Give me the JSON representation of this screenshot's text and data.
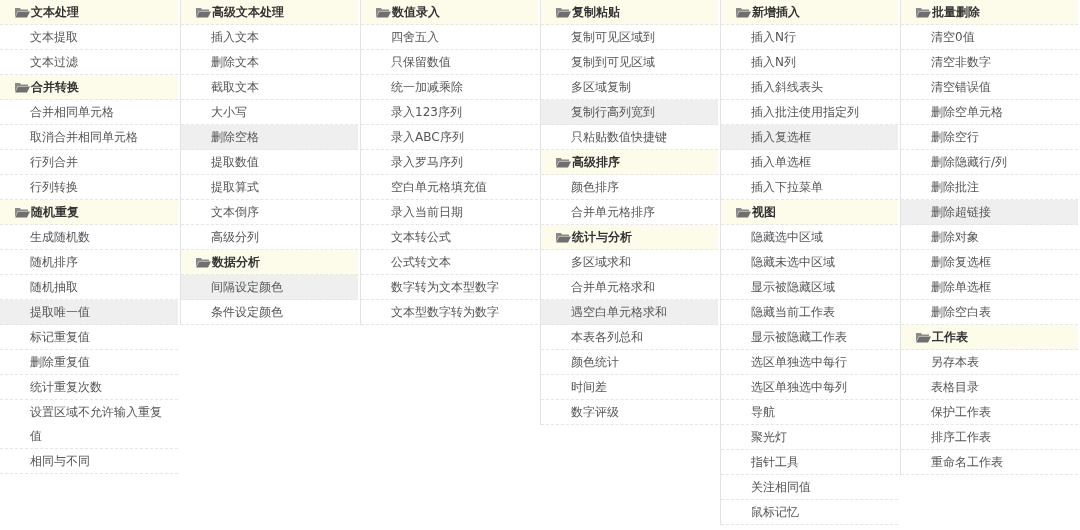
{
  "columns": [
    {
      "groups": [
        {
          "title": "文本处理",
          "items": [
            {
              "label": "文本提取",
              "selected": false
            },
            {
              "label": "文本过滤",
              "selected": false
            }
          ]
        },
        {
          "title": "合并转换",
          "items": [
            {
              "label": "合并相同单元格",
              "selected": false
            },
            {
              "label": "取消合并相同单元格",
              "selected": false
            },
            {
              "label": "行列合并",
              "selected": false
            },
            {
              "label": "行列转换",
              "selected": false
            }
          ]
        },
        {
          "title": "随机重复",
          "items": [
            {
              "label": "生成随机数",
              "selected": false
            },
            {
              "label": "随机排序",
              "selected": false
            },
            {
              "label": "随机抽取",
              "selected": false
            },
            {
              "label": "提取唯一值",
              "selected": true
            },
            {
              "label": "标记重复值",
              "selected": false
            },
            {
              "label": "删除重复值",
              "selected": false
            },
            {
              "label": "统计重复次数",
              "selected": false
            },
            {
              "label": "设置区域不允许输入重复值",
              "selected": false
            },
            {
              "label": "相同与不同",
              "selected": false
            }
          ]
        }
      ]
    },
    {
      "groups": [
        {
          "title": "高级文本处理",
          "items": [
            {
              "label": "插入文本",
              "selected": false
            },
            {
              "label": "删除文本",
              "selected": false
            },
            {
              "label": "截取文本",
              "selected": false
            },
            {
              "label": "大小写",
              "selected": false
            },
            {
              "label": "删除空格",
              "selected": true
            },
            {
              "label": "提取数值",
              "selected": false
            },
            {
              "label": "提取算式",
              "selected": false
            },
            {
              "label": "文本倒序",
              "selected": false
            },
            {
              "label": "高级分列",
              "selected": false
            }
          ]
        },
        {
          "title": "数据分析",
          "items": [
            {
              "label": "间隔设定颜色",
              "selected": true
            },
            {
              "label": "条件设定颜色",
              "selected": false
            }
          ]
        }
      ]
    },
    {
      "groups": [
        {
          "title": "数值录入",
          "items": [
            {
              "label": "四舍五入",
              "selected": false
            },
            {
              "label": "只保留数值",
              "selected": false
            },
            {
              "label": "统一加减乘除",
              "selected": false
            },
            {
              "label": "录入123序列",
              "selected": false
            },
            {
              "label": "录入ABC序列",
              "selected": false
            },
            {
              "label": "录入罗马序列",
              "selected": false
            },
            {
              "label": "空白单元格填充值",
              "selected": false
            },
            {
              "label": "录入当前日期",
              "selected": false
            },
            {
              "label": "文本转公式",
              "selected": false
            },
            {
              "label": "公式转文本",
              "selected": false
            },
            {
              "label": "数字转为文本型数字",
              "selected": false
            },
            {
              "label": "文本型数字转为数字",
              "selected": false
            }
          ]
        }
      ]
    },
    {
      "groups": [
        {
          "title": "复制粘贴",
          "items": [
            {
              "label": "复制可见区域到",
              "selected": false
            },
            {
              "label": "复制到可见区域",
              "selected": false
            },
            {
              "label": "多区域复制",
              "selected": false
            },
            {
              "label": "复制行高列宽到",
              "selected": true
            },
            {
              "label": "只粘贴数值快捷键",
              "selected": false
            }
          ]
        },
        {
          "title": "高级排序",
          "items": [
            {
              "label": "颜色排序",
              "selected": false
            },
            {
              "label": "合并单元格排序",
              "selected": false
            }
          ]
        },
        {
          "title": "统计与分析",
          "items": [
            {
              "label": "多区域求和",
              "selected": false
            },
            {
              "label": "合并单元格求和",
              "selected": false
            },
            {
              "label": "遇空白单元格求和",
              "selected": true
            },
            {
              "label": "本表各列总和",
              "selected": false
            },
            {
              "label": "颜色统计",
              "selected": false
            },
            {
              "label": "时间差",
              "selected": false
            },
            {
              "label": "数字评级",
              "selected": false
            }
          ]
        }
      ]
    },
    {
      "groups": [
        {
          "title": "新增插入",
          "items": [
            {
              "label": "插入N行",
              "selected": false
            },
            {
              "label": "插入N列",
              "selected": false
            },
            {
              "label": "插入斜线表头",
              "selected": false
            },
            {
              "label": "插入批注使用指定列",
              "selected": false
            },
            {
              "label": "插入复选框",
              "selected": true
            },
            {
              "label": "插入单选框",
              "selected": false
            },
            {
              "label": "插入下拉菜单",
              "selected": false
            }
          ]
        },
        {
          "title": "视图",
          "items": [
            {
              "label": "隐藏选中区域",
              "selected": false
            },
            {
              "label": "隐藏未选中区域",
              "selected": false
            },
            {
              "label": "显示被隐藏区域",
              "selected": false
            },
            {
              "label": "隐藏当前工作表",
              "selected": false
            },
            {
              "label": "显示被隐藏工作表",
              "selected": false
            },
            {
              "label": "选区单独选中每行",
              "selected": false
            },
            {
              "label": "选区单独选中每列",
              "selected": false
            },
            {
              "label": "导航",
              "selected": false
            },
            {
              "label": "聚光灯",
              "selected": false
            },
            {
              "label": "指针工具",
              "selected": false
            },
            {
              "label": "关注相同值",
              "selected": false
            },
            {
              "label": "鼠标记忆",
              "selected": false
            }
          ]
        }
      ]
    },
    {
      "groups": [
        {
          "title": "批量删除",
          "items": [
            {
              "label": "清空0值",
              "selected": false
            },
            {
              "label": "清空非数字",
              "selected": false
            },
            {
              "label": "清空错误值",
              "selected": false
            },
            {
              "label": "删除空单元格",
              "selected": false
            },
            {
              "label": "删除空行",
              "selected": false
            },
            {
              "label": "删除隐藏行/列",
              "selected": false
            },
            {
              "label": "删除批注",
              "selected": false
            },
            {
              "label": "删除超链接",
              "selected": true
            },
            {
              "label": "删除对象",
              "selected": false
            },
            {
              "label": "删除复选框",
              "selected": false
            },
            {
              "label": "删除单选框",
              "selected": false
            },
            {
              "label": "删除空白表",
              "selected": false
            }
          ]
        },
        {
          "title": "工作表",
          "items": [
            {
              "label": "另存本表",
              "selected": false
            },
            {
              "label": "表格目录",
              "selected": false
            },
            {
              "label": "保护工作表",
              "selected": false
            },
            {
              "label": "排序工作表",
              "selected": false
            },
            {
              "label": "重命名工作表",
              "selected": false
            }
          ]
        }
      ]
    }
  ]
}
